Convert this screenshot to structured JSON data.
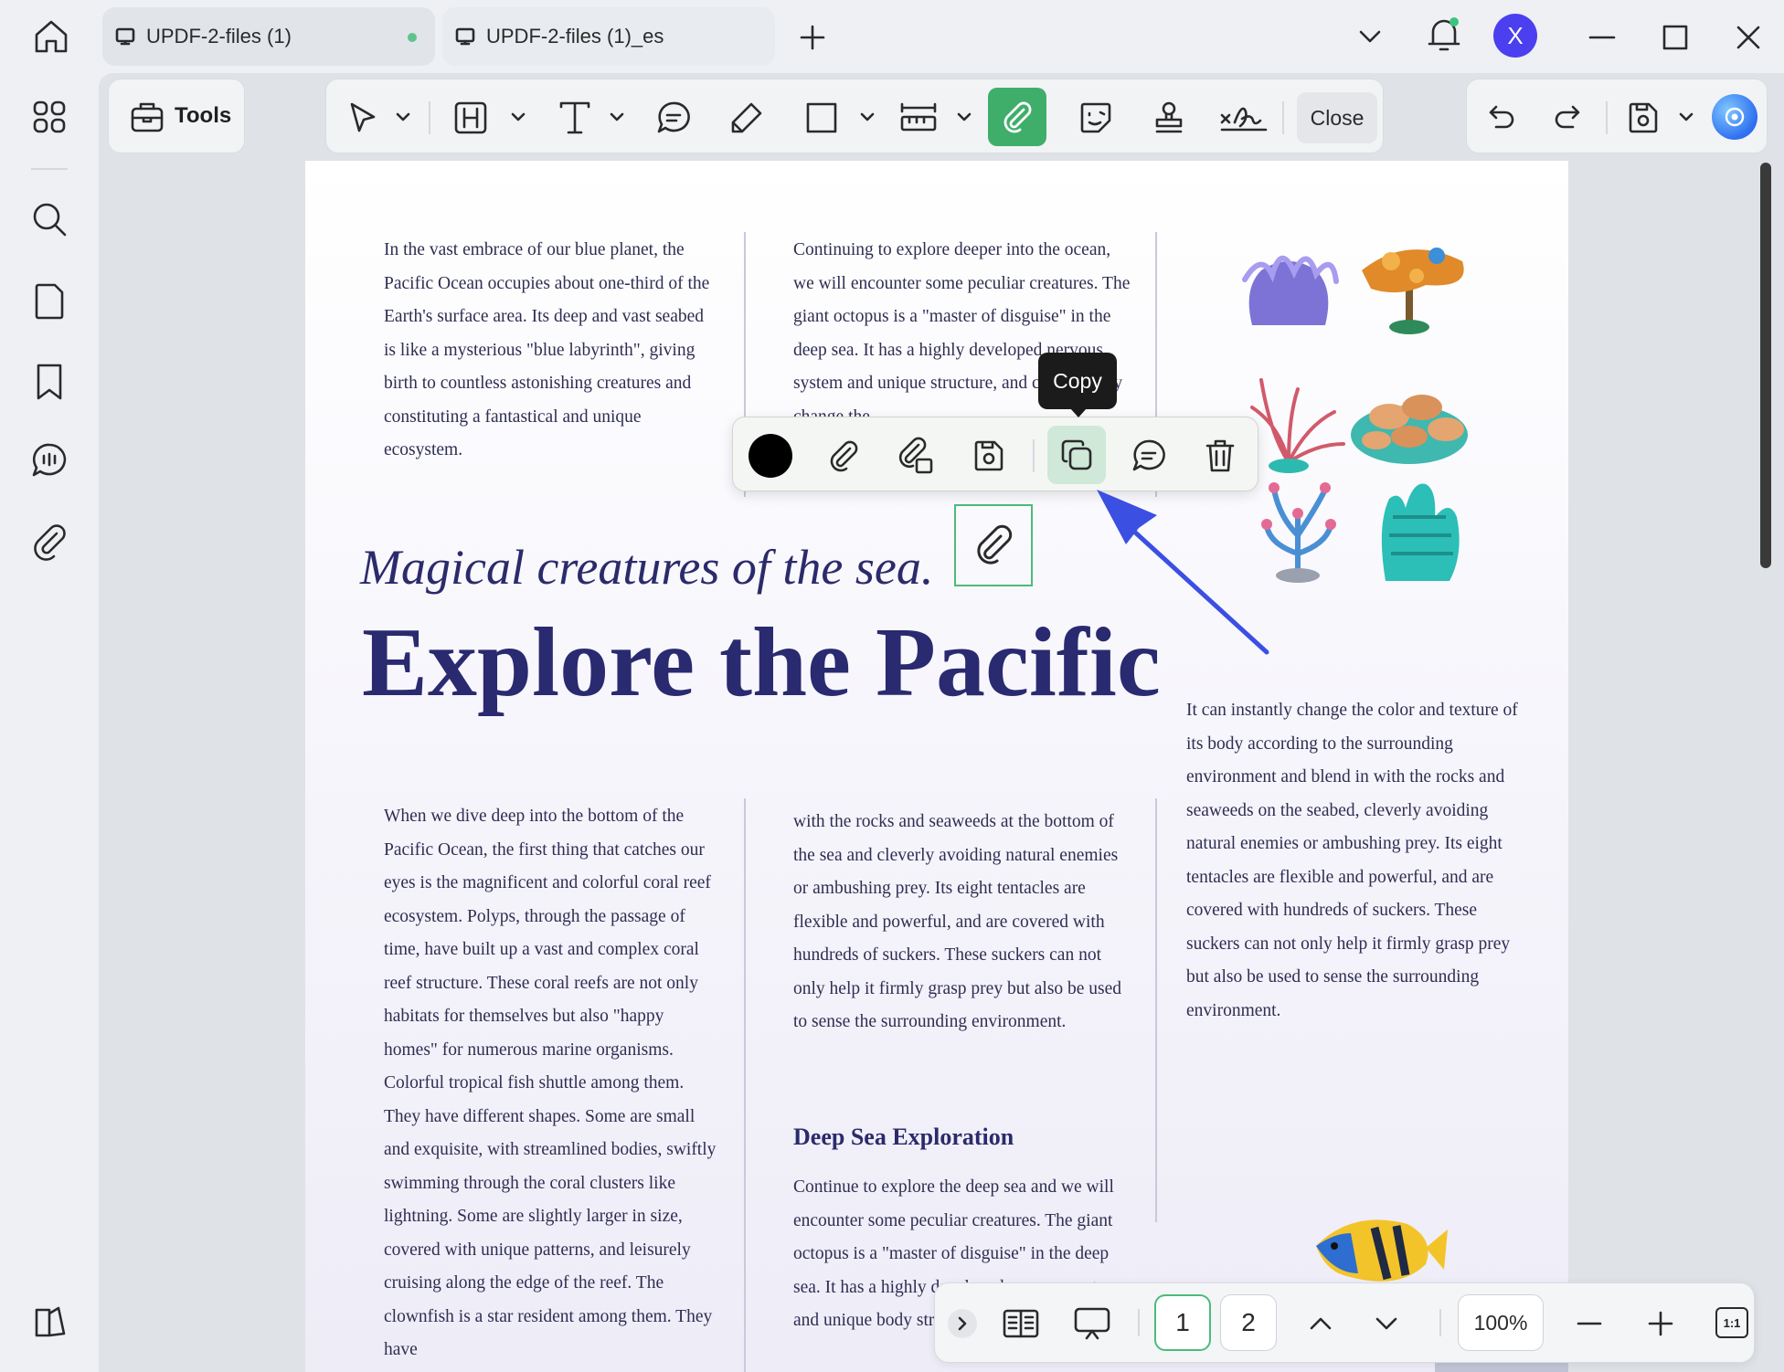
{
  "tabs": [
    {
      "label": "UPDF-2-files (1)",
      "active": true
    },
    {
      "label": "UPDF-2-files (1)_es",
      "active": false
    }
  ],
  "user": {
    "avatar_initial": "X",
    "avatar_color": "#4b3ff0"
  },
  "toolbar": {
    "tools_label": "Tools",
    "close_label": "Close",
    "attachment_active_color": "#3fae6b"
  },
  "annotation_toolbar": {
    "tooltip": "Copy",
    "color_swatch": "#000000"
  },
  "document": {
    "col1_top": "In the vast embrace of our blue planet, the Pacific Ocean occupies about one-third of the Earth's surface area. Its deep and vast seabed is like a mysterious \"blue labyrinth\", giving birth to countless astonishing creatures and constituting a fantastical and unique ecosystem.",
    "col2_top": "Continuing to explore deeper into the ocean, we will encounter some peculiar creatures. The giant octopus is a \"master of disguise\" in the deep sea. It has a highly developed nervous system and unique structure, and can instantly change the",
    "subtitle": "Magical creatures of the sea.",
    "title": "Explore the Pacific",
    "col3_mid": "It can instantly change the color and texture of its body according to the surrounding environment and blend in with the rocks and seaweeds on the seabed, cleverly avoiding natural enemies or ambushing prey. Its eight tentacles are flexible and powerful, and are covered with hundreds of suckers. These suckers can not only help it firmly grasp prey but also be used to sense the surrounding environment.",
    "col1_bottom": "When we dive deep into the bottom of the Pacific Ocean, the first thing that catches our eyes is the magnificent and colorful coral reef ecosystem. Polyps, through the passage of time, have built up a vast and complex coral reef structure. These coral reefs are not only habitats for themselves but also \"happy homes\" for numerous marine organisms. Colorful tropical fish shuttle among them. They have different shapes. Some are small and exquisite, with streamlined bodies, swiftly swimming through the coral clusters like lightning. Some are slightly larger in size, covered with unique patterns, and leisurely cruising along the edge of the reef. The clownfish is a star resident among them. They have",
    "col2_bottom": "with the rocks and seaweeds at the bottom of the sea and cleverly avoiding natural enemies or ambushing prey. Its eight tentacles are flexible and powerful, and are covered with hundreds of suckers. These suckers can not only help it firmly grasp prey but also be used to sense the surrounding environment.",
    "section_heading": "Deep Sea Exploration",
    "section_text": "Continue to explore the deep sea and we will encounter some peculiar creatures. The giant octopus is a \"master of disguise\" in the deep sea. It has a highly developed nervous system and unique body structure."
  },
  "pagination": {
    "page1": "1",
    "page2": "2",
    "zoom": "100%",
    "fit_label": "1:1"
  }
}
